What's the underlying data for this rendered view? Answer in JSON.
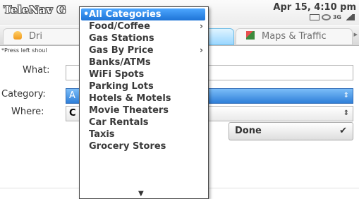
{
  "header": {
    "app_title": "TeleNav G",
    "datetime": "Apr 15, 4:10 pm",
    "network": "3G",
    "status_icons": [
      "mail-icon",
      "sync-icon",
      "network-3g-icon",
      "signal-icon"
    ]
  },
  "tabs": [
    {
      "label": "Dri",
      "icon": "car-icon"
    },
    {
      "label": "",
      "icon": ""
    },
    {
      "label": "Maps & Traffic",
      "icon": "map-icon"
    }
  ],
  "form": {
    "hint": "*Press left shoul",
    "what_label": "What:",
    "what_value": "",
    "category_label": "Category:",
    "category_value": "A",
    "where_label": "Where:",
    "where_value": "C",
    "done_label": "Done"
  },
  "dropdown": {
    "items": [
      {
        "label": "All Categories",
        "selected": true,
        "submenu": false
      },
      {
        "label": "Food/Coffee",
        "selected": false,
        "submenu": true
      },
      {
        "label": "Gas Stations",
        "selected": false,
        "submenu": false
      },
      {
        "label": "Gas By Price",
        "selected": false,
        "submenu": true
      },
      {
        "label": "Banks/ATMs",
        "selected": false,
        "submenu": false
      },
      {
        "label": "WiFi Spots",
        "selected": false,
        "submenu": false
      },
      {
        "label": "Parking Lots",
        "selected": false,
        "submenu": false
      },
      {
        "label": "Hotels & Motels",
        "selected": false,
        "submenu": false
      },
      {
        "label": "Movie Theaters",
        "selected": false,
        "submenu": false
      },
      {
        "label": "Car Rentals",
        "selected": false,
        "submenu": false
      },
      {
        "label": "Taxis",
        "selected": false,
        "submenu": false
      },
      {
        "label": "Grocery Stores",
        "selected": false,
        "submenu": false
      }
    ]
  },
  "colors": {
    "accent": "#1e73d6",
    "tab_active": "#99d6ff"
  }
}
